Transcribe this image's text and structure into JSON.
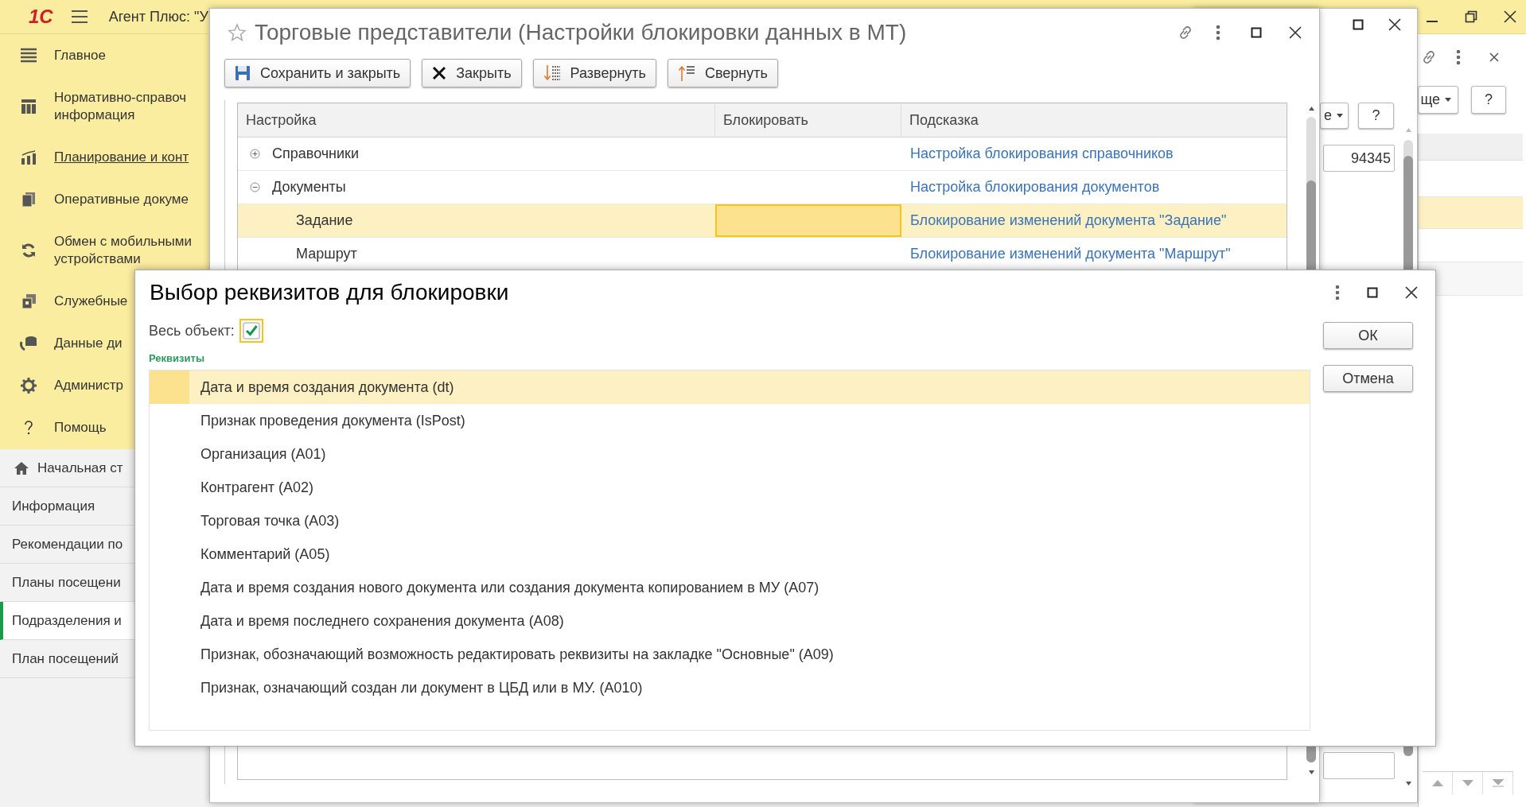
{
  "app": {
    "logo": "1С",
    "title": "Агент Плюс: \"У",
    "sections": [
      {
        "lines": [
          "Главное"
        ],
        "hovered": false
      },
      {
        "lines": [
          "Нормативно-справоч",
          "информация"
        ],
        "hovered": false
      },
      {
        "lines": [
          "Планирование и конт"
        ],
        "hovered": true
      },
      {
        "lines": [
          "Оперативные докуме"
        ],
        "hovered": false
      },
      {
        "lines": [
          "Обмен с мобильными",
          "устройствами"
        ],
        "hovered": false
      },
      {
        "lines": [
          "Служебные"
        ],
        "hovered": false
      },
      {
        "lines": [
          "Данные ди"
        ],
        "hovered": false
      },
      {
        "lines": [
          "Администр"
        ],
        "hovered": false
      },
      {
        "lines": [
          "Помощь"
        ],
        "hovered": false
      }
    ],
    "nav": [
      {
        "label": "Начальная ст",
        "selected": false
      },
      {
        "label": "Информация",
        "selected": false
      },
      {
        "label": "Рекомендации по",
        "selected": false
      },
      {
        "label": "Планы посещени",
        "selected": false
      },
      {
        "label": "Подразделения и",
        "selected": true
      },
      {
        "label": "План посещений",
        "selected": false
      }
    ]
  },
  "right_window": {
    "buttons": [
      {
        "label": "ще",
        "dropdown": true
      },
      {
        "label": "?",
        "dropdown": false
      }
    ]
  },
  "back_window": {
    "buttons": [
      {
        "label": "е",
        "dropdown": true
      },
      {
        "label": "?",
        "dropdown": false
      }
    ],
    "field": {
      "value": "94345"
    }
  },
  "main_window": {
    "title": "Торговые представители (Настройки блокировки данных в МТ)",
    "toolbar": [
      "Сохранить и закрыть",
      "Закрыть",
      "Развернуть",
      "Свернуть"
    ],
    "table": {
      "columns": [
        "Настройка",
        "Блокировать",
        "Подсказка"
      ],
      "rows": [
        {
          "setting": "Справочники",
          "hint": "Настройка блокирования справочников",
          "expanded": false,
          "selected": false
        },
        {
          "setting": "Документы",
          "hint": "Настройка блокирования документов",
          "expanded": true,
          "selected": false,
          "children": [
            {
              "setting": "Задание",
              "hint": "Блокирование изменений документа \"Задание\"",
              "selected": true
            },
            {
              "setting": "Маршрут",
              "hint": "Блокирование изменений документа \"Маршрут\"",
              "selected": false
            }
          ]
        }
      ]
    }
  },
  "dialog": {
    "title": "Выбор реквизитов для блокировки",
    "whole_object": {
      "label": "Весь объект:",
      "checked": true
    },
    "group_label": "Реквизиты",
    "items": [
      {
        "label": "Дата и время создания документа (dt)",
        "selected": true
      },
      {
        "label": "Признак проведения документа (IsPost)",
        "selected": false
      },
      {
        "label": "Организация (A01)",
        "selected": false
      },
      {
        "label": "Контрагент (A02)",
        "selected": false
      },
      {
        "label": "Торговая точка (A03)",
        "selected": false
      },
      {
        "label": "Комментарий (A05)",
        "selected": false
      },
      {
        "label": "Дата и время создания нового документа или создания документа копированием в МУ (A07)",
        "selected": false
      },
      {
        "label": "Дата и время последнего сохранения документа (A08)",
        "selected": false
      },
      {
        "label": "Признак, обозначающий возможность редактировать реквизиты на закладке \"Основные\" (A09)",
        "selected": false
      },
      {
        "label": "Признак, означающий создан ли документ в ЦБД или в МУ. (A010)",
        "selected": false
      }
    ],
    "buttons": [
      "ОК",
      "Отмена"
    ]
  }
}
